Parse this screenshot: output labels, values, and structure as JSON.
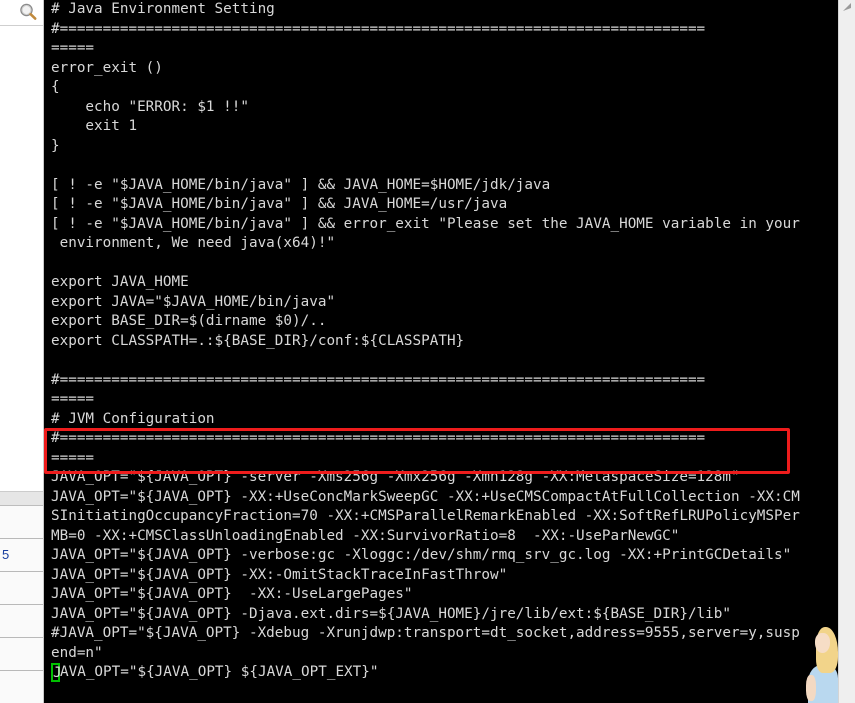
{
  "window": {
    "background_panel_label": "spreadsheet",
    "terminal_bg": "#000000",
    "terminal_fg": "#d8d8d8",
    "annotation_color": "#ee1c1c",
    "cursor_color": "#00c000"
  },
  "sidebar": {
    "search_icon": "magnifier-icon",
    "rows": [
      {
        "value": ""
      },
      {
        "value": "5"
      },
      {
        "value": ""
      },
      {
        "value": ""
      },
      {
        "value": ""
      },
      {
        "value": ""
      }
    ]
  },
  "scrollbar": {
    "up_arrow_icon": "scroll-up-arrow-icon"
  },
  "terminal": {
    "lines": [
      "# Java Environment Setting",
      "#===========================================================================",
      "=====",
      "error_exit ()",
      "{",
      "    echo \"ERROR: $1 !!\"",
      "    exit 1",
      "}",
      "",
      "[ ! -e \"$JAVA_HOME/bin/java\" ] && JAVA_HOME=$HOME/jdk/java",
      "[ ! -e \"$JAVA_HOME/bin/java\" ] && JAVA_HOME=/usr/java",
      "[ ! -e \"$JAVA_HOME/bin/java\" ] && error_exit \"Please set the JAVA_HOME variable in your",
      " environment, We need java(x64)!\"",
      "",
      "export JAVA_HOME",
      "export JAVA=\"$JAVA_HOME/bin/java\"",
      "export BASE_DIR=$(dirname $0)/..",
      "export CLASSPATH=.:${BASE_DIR}/conf:${CLASSPATH}",
      "",
      "#===========================================================================",
      "=====",
      "# JVM Configuration",
      "#===========================================================================",
      "=====",
      "JAVA_OPT=\"${JAVA_OPT} -server -Xms256g -Xmx256g -Xmn128g -XX:MetaspaceSize=128m\"",
      "JAVA_OPT=\"${JAVA_OPT} -XX:+UseConcMarkSweepGC -XX:+UseCMSCompactAtFullCollection -XX:CM",
      "SInitiatingOccupancyFraction=70 -XX:+CMSParallelRemarkEnabled -XX:SoftRefLRUPolicyMSPer",
      "MB=0 -XX:+CMSClassUnloadingEnabled -XX:SurvivorRatio=8  -XX:-UseParNewGC\"",
      "JAVA_OPT=\"${JAVA_OPT} -verbose:gc -Xloggc:/dev/shm/rmq_srv_gc.log -XX:+PrintGCDetails\"",
      "JAVA_OPT=\"${JAVA_OPT} -XX:-OmitStackTraceInFastThrow\"",
      "JAVA_OPT=\"${JAVA_OPT}  -XX:-UseLargePages\"",
      "JAVA_OPT=\"${JAVA_OPT} -Djava.ext.dirs=${JAVA_HOME}/jre/lib/ext:${BASE_DIR}/lib\"",
      "#JAVA_OPT=\"${JAVA_OPT} -Xdebug -Xrunjdwp:transport=dt_socket,address=9555,server=y,susp",
      "end=n\""
    ],
    "cursor_line": {
      "cursor_char": "J",
      "rest": "AVA_OPT=\"${JAVA_OPT} ${JAVA_OPT_EXT}\""
    },
    "highlighted_lines": [
      "=====",
      "JAVA_OPT=\"${JAVA_OPT} -server -Xms256g -Xmx256g -Xmn128g -XX:MetaspaceSize=128m\""
    ]
  }
}
